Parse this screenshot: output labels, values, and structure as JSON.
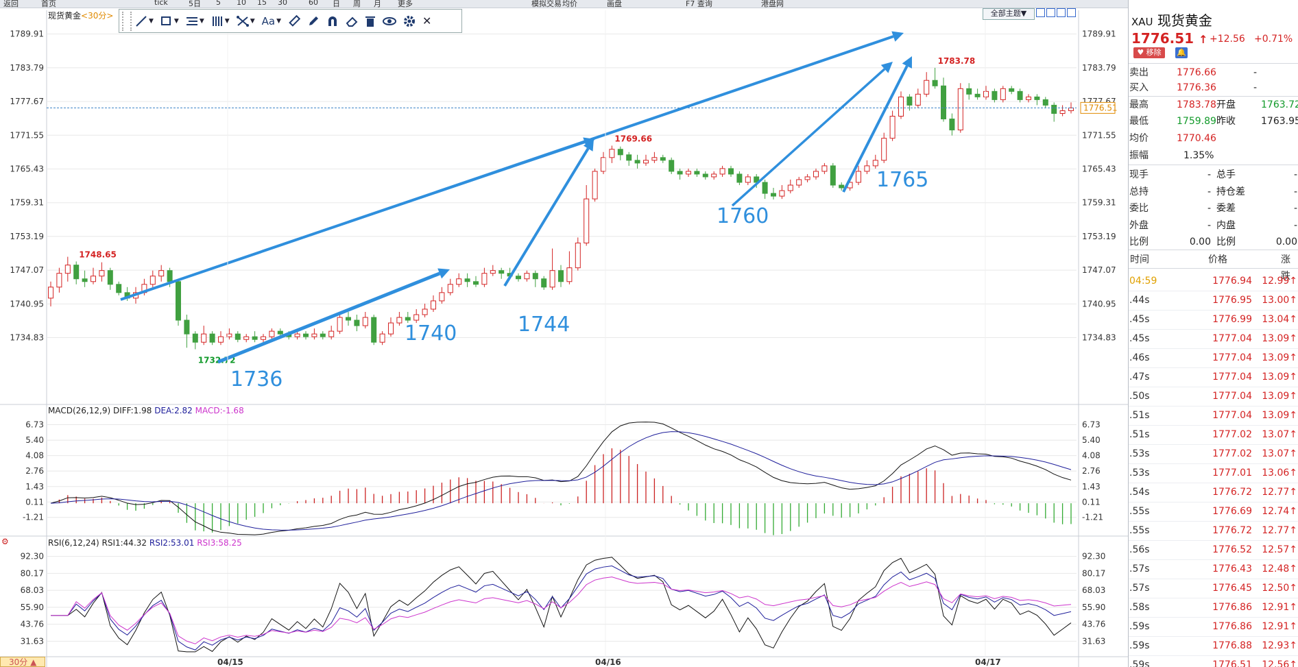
{
  "topbar": {
    "items": [
      "返回",
      "首页",
      "",
      "tick",
      "5日",
      "5",
      "10",
      "15",
      "30",
      "60",
      "日",
      "周",
      "月",
      "更多",
      "",
      "",
      "模拟交易",
      "均价",
      "",
      "画盘",
      "",
      "F7 查询",
      "",
      "港盘网"
    ]
  },
  "chart": {
    "symbol_title": "现货黄金",
    "period_label": "<30分>",
    "theme_button": "全部主题▼",
    "period_button": "30分 ▲",
    "colors": {
      "up": "#d42323",
      "down": "#40a040",
      "grid": "#e8e8e8",
      "blue_arrow": "#2f8fdd",
      "macd_diff": "#111111",
      "macd_dea": "#1d1d9a",
      "macd_hist_up": "#c22",
      "macd_hist_down": "#3a3",
      "rsi1": "#111111",
      "rsi2": "#1d1d9a",
      "rsi3": "#cc33cc"
    },
    "price_axis": [
      "1789.91",
      "1783.79",
      "1777.67",
      "1771.55",
      "1765.43",
      "1759.31",
      "1753.19",
      "1747.07",
      "1740.95",
      "1734.83"
    ],
    "price_range": [
      1729.8,
      1792.1
    ],
    "current_price_tag": "1776.51",
    "date_labels": [
      "04/15",
      "04/16",
      "04/17"
    ],
    "candles": [
      [
        1742.0,
        1744.0,
        1745.0,
        1740.5
      ],
      [
        1744.0,
        1746.5,
        1747.5,
        1743.0
      ],
      [
        1746.5,
        1748.0,
        1749.5,
        1745.0
      ],
      [
        1748.0,
        1745.5,
        1748.65,
        1744.5
      ],
      [
        1745.5,
        1745.0,
        1747.0,
        1744.0
      ],
      [
        1745.0,
        1746.0,
        1747.5,
        1744.5
      ],
      [
        1746.0,
        1747.0,
        1748.5,
        1745.0
      ],
      [
        1747.0,
        1744.5,
        1747.5,
        1743.5
      ],
      [
        1744.5,
        1743.0,
        1745.0,
        1742.5
      ],
      [
        1743.0,
        1742.0,
        1744.0,
        1741.5
      ],
      [
        1742.0,
        1743.0,
        1744.0,
        1741.0
      ],
      [
        1743.0,
        1744.5,
        1745.5,
        1742.5
      ],
      [
        1744.5,
        1746.0,
        1747.0,
        1743.5
      ],
      [
        1746.0,
        1747.0,
        1748.0,
        1745.0
      ],
      [
        1747.0,
        1745.0,
        1747.5,
        1744.0
      ],
      [
        1745.0,
        1738.0,
        1745.5,
        1737.0
      ],
      [
        1738.0,
        1735.5,
        1739.0,
        1733.0
      ],
      [
        1735.5,
        1734.0,
        1736.0,
        1732.72
      ],
      [
        1734.0,
        1735.5,
        1737.0,
        1733.5
      ],
      [
        1735.5,
        1734.0,
        1736.0,
        1733.5
      ],
      [
        1734.0,
        1735.0,
        1736.0,
        1733.5
      ],
      [
        1735.0,
        1735.5,
        1736.5,
        1734.5
      ],
      [
        1735.5,
        1734.5,
        1736.0,
        1734.0
      ],
      [
        1734.5,
        1735.0,
        1735.5,
        1734.0
      ],
      [
        1735.0,
        1734.5,
        1736.0,
        1734.0
      ],
      [
        1734.5,
        1735.0,
        1735.5,
        1734.0
      ],
      [
        1735.0,
        1736.0,
        1736.5,
        1734.5
      ],
      [
        1736.0,
        1735.5,
        1736.5,
        1735.0
      ],
      [
        1735.5,
        1735.0,
        1736.0,
        1734.5
      ],
      [
        1735.0,
        1735.5,
        1736.0,
        1734.5
      ],
      [
        1735.5,
        1735.0,
        1736.0,
        1734.5
      ],
      [
        1735.0,
        1735.5,
        1736.5,
        1734.5
      ],
      [
        1735.5,
        1735.0,
        1736.0,
        1734.5
      ],
      [
        1735.0,
        1736.0,
        1737.0,
        1734.5
      ],
      [
        1736.0,
        1738.5,
        1739.5,
        1735.5
      ],
      [
        1738.5,
        1738.0,
        1739.5,
        1737.0
      ],
      [
        1738.0,
        1737.0,
        1739.0,
        1736.0
      ],
      [
        1737.0,
        1738.5,
        1739.5,
        1736.5
      ],
      [
        1738.5,
        1734.0,
        1739.0,
        1733.5
      ],
      [
        1734.0,
        1735.5,
        1736.0,
        1733.5
      ],
      [
        1735.5,
        1737.5,
        1738.5,
        1735.0
      ],
      [
        1737.5,
        1738.5,
        1739.5,
        1737.0
      ],
      [
        1738.5,
        1738.0,
        1739.5,
        1737.5
      ],
      [
        1738.0,
        1739.0,
        1740.0,
        1737.5
      ],
      [
        1739.0,
        1740.0,
        1741.0,
        1738.5
      ],
      [
        1740.0,
        1741.5,
        1742.5,
        1739.5
      ],
      [
        1741.5,
        1743.0,
        1744.0,
        1741.0
      ],
      [
        1743.0,
        1744.5,
        1745.5,
        1742.5
      ],
      [
        1744.5,
        1745.5,
        1746.5,
        1744.0
      ],
      [
        1745.5,
        1745.0,
        1746.5,
        1744.0
      ],
      [
        1745.0,
        1744.5,
        1746.0,
        1744.0
      ],
      [
        1744.5,
        1746.5,
        1747.5,
        1744.0
      ],
      [
        1746.5,
        1747.0,
        1748.0,
        1746.0
      ],
      [
        1747.0,
        1746.5,
        1747.5,
        1745.5
      ],
      [
        1746.5,
        1746.0,
        1747.5,
        1745.5
      ],
      [
        1746.0,
        1745.5,
        1746.5,
        1745.0
      ],
      [
        1745.5,
        1746.5,
        1747.0,
        1745.0
      ],
      [
        1746.5,
        1745.5,
        1747.0,
        1744.0
      ],
      [
        1745.5,
        1744.0,
        1746.0,
        1743.5
      ],
      [
        1744.0,
        1747.0,
        1751.0,
        1743.5
      ],
      [
        1747.0,
        1745.0,
        1748.0,
        1744.0
      ],
      [
        1745.0,
        1747.5,
        1750.5,
        1744.5
      ],
      [
        1747.5,
        1752.0,
        1753.0,
        1747.0
      ],
      [
        1752.0,
        1760.0,
        1762.5,
        1751.5
      ],
      [
        1760.0,
        1765.0,
        1765.5,
        1759.5
      ],
      [
        1765.0,
        1767.5,
        1768.5,
        1764.5
      ],
      [
        1767.5,
        1769.0,
        1769.66,
        1766.5
      ],
      [
        1769.0,
        1768.0,
        1769.5,
        1767.0
      ],
      [
        1768.0,
        1767.0,
        1768.5,
        1766.0
      ],
      [
        1767.0,
        1766.5,
        1768.0,
        1765.5
      ],
      [
        1766.5,
        1767.0,
        1768.0,
        1766.0
      ],
      [
        1767.0,
        1767.5,
        1768.5,
        1766.5
      ],
      [
        1767.5,
        1767.0,
        1768.0,
        1766.5
      ],
      [
        1767.0,
        1765.0,
        1767.5,
        1764.5
      ],
      [
        1765.0,
        1764.5,
        1765.5,
        1763.5
      ],
      [
        1764.5,
        1765.0,
        1765.5,
        1764.0
      ],
      [
        1765.0,
        1764.5,
        1765.5,
        1764.0
      ],
      [
        1764.5,
        1764.0,
        1765.0,
        1763.5
      ],
      [
        1764.0,
        1764.5,
        1765.0,
        1763.5
      ],
      [
        1764.5,
        1765.5,
        1766.0,
        1764.0
      ],
      [
        1765.5,
        1764.5,
        1766.0,
        1764.0
      ],
      [
        1764.5,
        1763.0,
        1765.0,
        1762.5
      ],
      [
        1763.0,
        1764.0,
        1764.5,
        1762.5
      ],
      [
        1764.0,
        1763.0,
        1764.5,
        1762.0
      ],
      [
        1763.0,
        1761.0,
        1763.5,
        1760.0
      ],
      [
        1761.0,
        1760.5,
        1762.0,
        1759.89
      ],
      [
        1760.5,
        1761.5,
        1762.5,
        1760.0
      ],
      [
        1761.5,
        1762.5,
        1763.5,
        1761.0
      ],
      [
        1762.5,
        1763.5,
        1764.0,
        1762.0
      ],
      [
        1763.5,
        1764.0,
        1764.5,
        1763.0
      ],
      [
        1764.0,
        1765.0,
        1765.5,
        1763.5
      ],
      [
        1765.0,
        1766.0,
        1766.5,
        1764.5
      ],
      [
        1766.0,
        1762.5,
        1766.5,
        1762.0
      ],
      [
        1762.5,
        1762.0,
        1763.0,
        1761.5
      ],
      [
        1762.0,
        1763.0,
        1764.0,
        1761.5
      ],
      [
        1763.0,
        1765.0,
        1766.0,
        1762.5
      ],
      [
        1765.0,
        1766.0,
        1767.0,
        1764.5
      ],
      [
        1766.0,
        1767.0,
        1768.0,
        1765.5
      ],
      [
        1767.0,
        1771.0,
        1772.0,
        1766.5
      ],
      [
        1771.0,
        1775.0,
        1776.0,
        1770.5
      ],
      [
        1775.0,
        1778.5,
        1779.5,
        1774.5
      ],
      [
        1778.5,
        1777.0,
        1779.0,
        1776.0
      ],
      [
        1777.0,
        1779.0,
        1780.0,
        1776.5
      ],
      [
        1779.0,
        1781.5,
        1783.0,
        1778.5
      ],
      [
        1781.5,
        1780.5,
        1783.78,
        1780.0
      ],
      [
        1780.5,
        1774.5,
        1782.0,
        1774.0
      ],
      [
        1774.5,
        1772.5,
        1775.5,
        1771.5
      ],
      [
        1772.5,
        1780.0,
        1781.0,
        1772.0
      ],
      [
        1780.0,
        1779.0,
        1781.0,
        1778.0
      ],
      [
        1779.0,
        1778.5,
        1780.0,
        1778.0
      ],
      [
        1778.5,
        1779.5,
        1780.5,
        1778.0
      ],
      [
        1779.5,
        1778.0,
        1780.0,
        1777.5
      ],
      [
        1778.0,
        1780.0,
        1780.5,
        1777.5
      ],
      [
        1780.0,
        1779.5,
        1780.5,
        1779.0
      ],
      [
        1779.5,
        1778.0,
        1780.0,
        1777.5
      ],
      [
        1778.0,
        1778.5,
        1779.0,
        1777.5
      ],
      [
        1778.5,
        1778.0,
        1779.0,
        1777.0
      ],
      [
        1778.0,
        1777.0,
        1778.5,
        1776.5
      ],
      [
        1777.0,
        1775.5,
        1777.5,
        1774.0
      ],
      [
        1775.5,
        1776.0,
        1777.0,
        1775.0
      ],
      [
        1776.0,
        1776.5,
        1777.5,
        1775.5
      ]
    ],
    "price_labels": [
      {
        "text": "1748.65",
        "candle": 3,
        "value": 1748.65,
        "color": "#d42323",
        "place": "above"
      },
      {
        "text": "1732.72",
        "candle": 17,
        "value": 1732.72,
        "color": "#129a2a",
        "place": "below"
      },
      {
        "text": "1769.66",
        "candle": 66,
        "value": 1769.66,
        "color": "#d42323",
        "place": "above"
      },
      {
        "text": "1783.78",
        "candle": 104,
        "value": 1783.78,
        "color": "#d42323",
        "place": "above"
      }
    ],
    "annotations": [
      "1736",
      "1740",
      "1744",
      "1760",
      "1765"
    ],
    "macd": {
      "label": "MACD(26,12,9)",
      "diff": "DIFF:1.98",
      "dea": "DEA:2.82",
      "macd": "MACD:-1.68",
      "axis": [
        "6.73",
        "5.40",
        "4.08",
        "2.76",
        "1.43",
        "0.11",
        "-1.21"
      ],
      "range": [
        -2.4,
        7.7
      ]
    },
    "rsi": {
      "label": "RSI(6,12,24)",
      "rsi1": "RSI1:44.32",
      "rsi2": "RSI2:53.01",
      "rsi3": "RSI3:58.25",
      "axis": [
        "92.30",
        "80.17",
        "68.03",
        "55.90",
        "43.76",
        "31.63"
      ],
      "range": [
        22.0,
        99.0
      ]
    }
  },
  "panel": {
    "symbol_code": "XAU",
    "symbol_name": "现货黄金",
    "price": "1776.51",
    "arrow": "↑",
    "change": "+12.56",
    "change_pct": "+0.71%",
    "remove_button": "♥ 移除",
    "bell_button": "🔔",
    "sell_label": "卖出",
    "sell_value": "1776.66",
    "sell_extra": "-",
    "buy_label": "买入",
    "buy_value": "1776.36",
    "buy_extra": "-",
    "high_label": "最高",
    "high_value": "1783.78",
    "open_label": "开盘",
    "open_value": "1763.72",
    "low_label": "最低",
    "low_value": "1759.89",
    "prev_label": "昨收",
    "prev_value": "1763.95",
    "avg_label": "均价",
    "avg_value": "1770.46",
    "amp_label": "振幅",
    "amp_value": "1.35%",
    "stats": [
      {
        "l1": "现手",
        "v1": "-",
        "l2": "总手",
        "v2": "-"
      },
      {
        "l1": "总持",
        "v1": "-",
        "l2": "持仓差",
        "v2": "-"
      },
      {
        "l1": "委比",
        "v1": "-",
        "l2": "委差",
        "v2": "-"
      },
      {
        "l1": "外盘",
        "v1": "-",
        "l2": "内盘",
        "v2": "-"
      },
      {
        "l1": "比例",
        "v1": "0.00",
        "l2": "比例",
        "v2": "0.00"
      }
    ],
    "table_headers": [
      "时间",
      "价格",
      "涨跌"
    ],
    "ticks": [
      {
        "t": "04:59",
        "p": "1776.94",
        "c": "12.99↑"
      },
      {
        "t": ".44s",
        "p": "1776.95",
        "c": "13.00↑"
      },
      {
        "t": ".45s",
        "p": "1776.99",
        "c": "13.04↑"
      },
      {
        "t": ".45s",
        "p": "1777.04",
        "c": "13.09↑"
      },
      {
        "t": ".46s",
        "p": "1777.04",
        "c": "13.09↑"
      },
      {
        "t": ".47s",
        "p": "1777.04",
        "c": "13.09↑"
      },
      {
        "t": ".50s",
        "p": "1777.04",
        "c": "13.09↑"
      },
      {
        "t": ".51s",
        "p": "1777.04",
        "c": "13.09↑"
      },
      {
        "t": ".51s",
        "p": "1777.02",
        "c": "13.07↑"
      },
      {
        "t": ".53s",
        "p": "1777.02",
        "c": "13.07↑"
      },
      {
        "t": ".53s",
        "p": "1777.01",
        "c": "13.06↑"
      },
      {
        "t": ".54s",
        "p": "1776.72",
        "c": "12.77↑"
      },
      {
        "t": ".55s",
        "p": "1776.69",
        "c": "12.74↑"
      },
      {
        "t": ".55s",
        "p": "1776.72",
        "c": "12.77↑"
      },
      {
        "t": ".56s",
        "p": "1776.52",
        "c": "12.57↑"
      },
      {
        "t": ".57s",
        "p": "1776.43",
        "c": "12.48↑"
      },
      {
        "t": ".57s",
        "p": "1776.45",
        "c": "12.50↑"
      },
      {
        "t": ".58s",
        "p": "1776.86",
        "c": "12.91↑"
      },
      {
        "t": ".59s",
        "p": "1776.86",
        "c": "12.91↑"
      },
      {
        "t": ".59s",
        "p": "1776.88",
        "c": "12.93↑"
      },
      {
        "t": ".59s",
        "p": "1776.51",
        "c": "12.56↑"
      }
    ]
  }
}
